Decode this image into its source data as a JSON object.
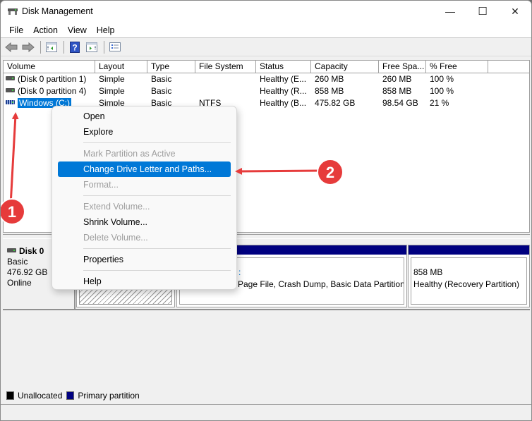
{
  "window": {
    "title": "Disk Management",
    "controls": {
      "minimize": "—",
      "maximize": "☐",
      "close": "✕"
    }
  },
  "menu": [
    "File",
    "Action",
    "View",
    "Help"
  ],
  "toolbar": {
    "buttons": [
      "back-icon",
      "forward-icon",
      "show-hide-console-tree-icon",
      "help-icon",
      "show-hide-action-pane-icon",
      "properties-icon"
    ]
  },
  "volume_list": {
    "columns": [
      "Volume",
      "Layout",
      "Type",
      "File System",
      "Status",
      "Capacity",
      "Free Spa...",
      "% Free"
    ],
    "rows": [
      {
        "volume": "(Disk 0 partition 1)",
        "layout": "Simple",
        "type": "Basic",
        "fs": "",
        "status": "Healthy (E...",
        "capacity": "260 MB",
        "free": "260 MB",
        "pct": "100 %"
      },
      {
        "volume": "(Disk 0 partition 4)",
        "layout": "Simple",
        "type": "Basic",
        "fs": "",
        "status": "Healthy (R...",
        "capacity": "858 MB",
        "free": "858 MB",
        "pct": "100 %"
      },
      {
        "volume": "Windows (C:)",
        "layout": "Simple",
        "type": "Basic",
        "fs": "NTFS",
        "status": "Healthy (B...",
        "capacity": "475.82 GB",
        "free": "98.54 GB",
        "pct": "21 %"
      }
    ],
    "selected_row": 2
  },
  "disk_graph": {
    "disk": {
      "name": "Disk 0",
      "type": "Basic",
      "size": "476.92 GB",
      "state": "Online"
    },
    "partitions": [
      {
        "lines": [
          "",
          ""
        ]
      },
      {
        "lines": [
          ":",
          "Page File, Crash Dump, Basic Data Partition)"
        ]
      },
      {
        "lines": [
          "858 MB",
          "Healthy (Recovery Partition)"
        ]
      }
    ]
  },
  "legend": [
    {
      "label": "Unallocated",
      "color": "#000000"
    },
    {
      "label": "Primary partition",
      "color": "#000080"
    }
  ],
  "context_menu": {
    "items": [
      {
        "label": "Open",
        "enabled": true
      },
      {
        "label": "Explore",
        "enabled": true
      },
      {
        "separator": true
      },
      {
        "label": "Mark Partition as Active",
        "enabled": false
      },
      {
        "label": "Change Drive Letter and Paths...",
        "enabled": true,
        "highlighted": true
      },
      {
        "label": "Format...",
        "enabled": false
      },
      {
        "separator": true
      },
      {
        "label": "Extend Volume...",
        "enabled": false
      },
      {
        "label": "Shrink Volume...",
        "enabled": true
      },
      {
        "label": "Delete Volume...",
        "enabled": false
      },
      {
        "separator": true
      },
      {
        "label": "Properties",
        "enabled": true
      },
      {
        "separator": true
      },
      {
        "label": "Help",
        "enabled": true
      }
    ]
  },
  "annotations": [
    {
      "number": "1",
      "color": "#e63b3b"
    },
    {
      "number": "2",
      "color": "#e63b3b"
    }
  ],
  "colors": {
    "selection": "#0078d7",
    "primary_partition": "#000080",
    "annotation": "#e63b3b"
  }
}
